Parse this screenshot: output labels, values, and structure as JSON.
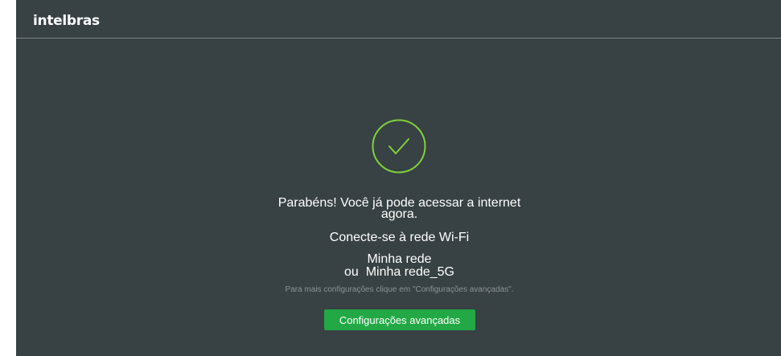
{
  "header": {
    "logo_text": "intelbras"
  },
  "success": {
    "icon": "checkmark-circle-icon",
    "accent_color": "#7fd13b"
  },
  "message": {
    "congrats_line1": "Parabéns! Você já pode acessar a internet",
    "congrats_line2": "agora.",
    "connect": "Conecte-se à rede Wi-Fi",
    "network_1": "Minha rede",
    "network_2": "ou  Minha rede_5G",
    "hint": "Para mais configurações clique em \"Configurações avançadas\"."
  },
  "actions": {
    "advanced_settings_label": "Configurações avançadas",
    "button_color": "#22a845"
  },
  "theme": {
    "background": "#384144"
  }
}
